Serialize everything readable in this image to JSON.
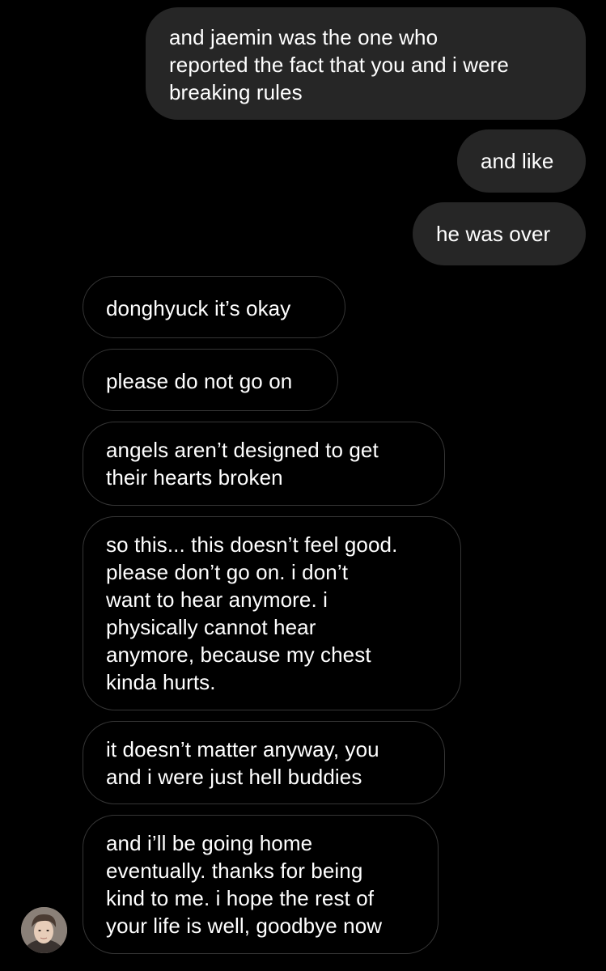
{
  "conversation": {
    "sent": [
      {
        "text": "and jaemin was the one who\nreported the fact that you and i were\nbreaking rules"
      },
      {
        "text": "and like"
      },
      {
        "text": "he was over"
      }
    ],
    "received": [
      {
        "text": "donghyuck it’s okay"
      },
      {
        "text": "please do not go on"
      },
      {
        "text": "angels aren’t designed to get\ntheir hearts broken"
      },
      {
        "text": "so this... this doesn’t feel good.\nplease don’t go on. i don’t\nwant to hear anymore. i\nphysically cannot hear\nanymore, because my chest\nkinda hurts."
      },
      {
        "text": "it doesn’t matter anyway, you\nand i were just hell buddies"
      },
      {
        "text": "and i’ll be going home\neventually. thanks for being\nkind to me. i hope the rest of\nyour life is well, goodbye now"
      }
    ]
  },
  "colors": {
    "background": "#000000",
    "sent_bubble": "#262626",
    "received_border": "#363636",
    "text": "#ffffff"
  },
  "icons": {
    "avatar": "contact-avatar-photo"
  }
}
